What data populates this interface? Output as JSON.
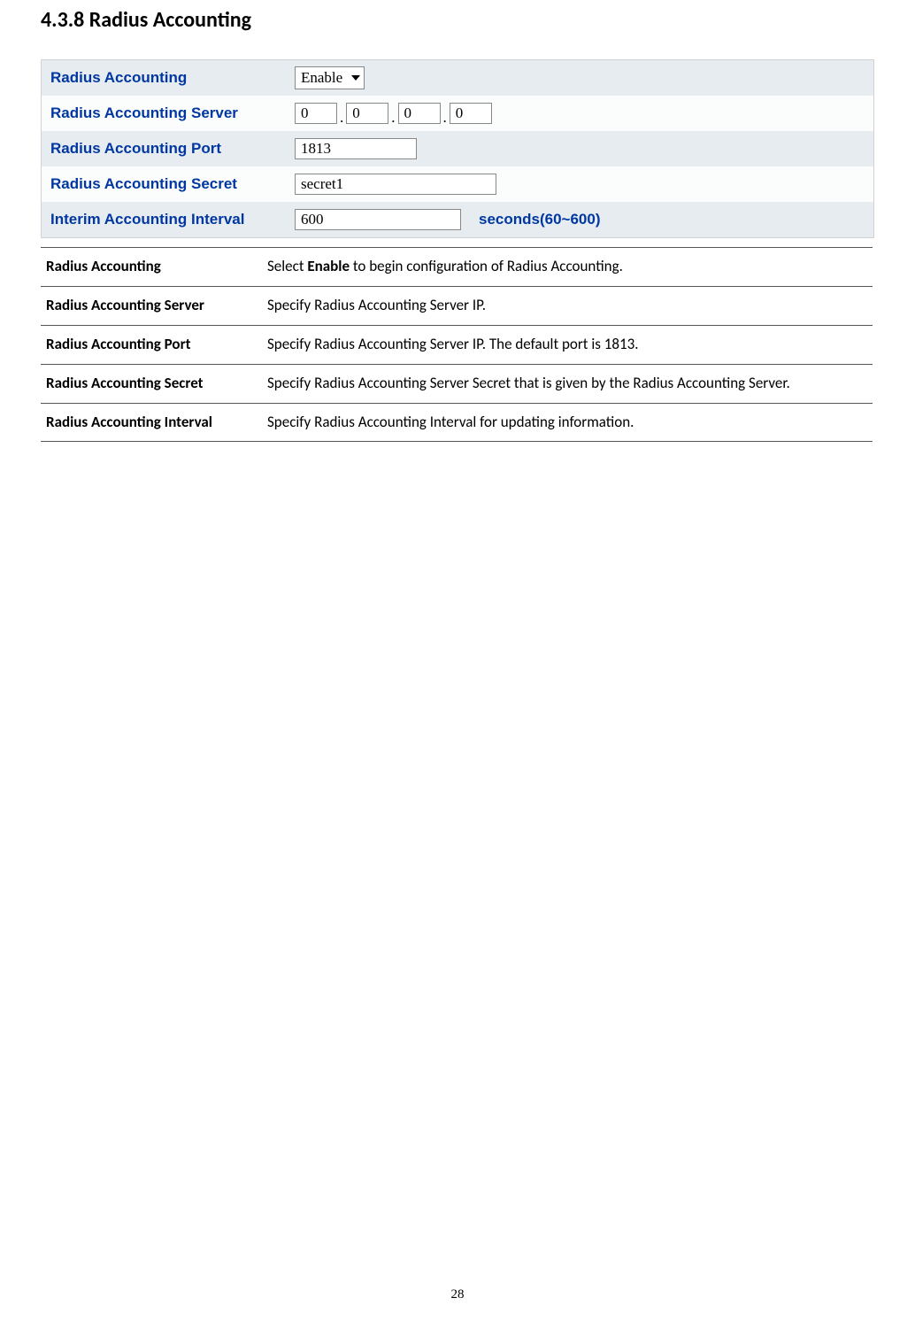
{
  "heading": "4.3.8 Radius Accounting",
  "config": {
    "rows": [
      {
        "label": "Radius Accounting",
        "type": "select",
        "value": "Enable"
      },
      {
        "label": "Radius Accounting Server",
        "type": "ip",
        "octets": [
          "0",
          "0",
          "0",
          "0"
        ]
      },
      {
        "label": "Radius Accounting Port",
        "type": "text",
        "value": "1813",
        "cls": "w-port"
      },
      {
        "label": "Radius Accounting Secret",
        "type": "text",
        "value": "secret1",
        "cls": "w-secret"
      },
      {
        "label": "Interim Accounting Interval",
        "type": "text",
        "value": "600",
        "cls": "w-interval",
        "suffix": "seconds(60~600)"
      }
    ]
  },
  "desc": [
    {
      "key": "Radius Accounting",
      "pre": "Select ",
      "strong": "Enable",
      "post": " to begin configuration of Radius Accounting."
    },
    {
      "key": "Radius Accounting Server",
      "pre": "Specify Radius Accounting Server IP.",
      "strong": "",
      "post": ""
    },
    {
      "key": "Radius Accounting Port",
      "pre": "Specify Radius Accounting Server IP. The default port is 1813.",
      "strong": "",
      "post": ""
    },
    {
      "key": "Radius Accounting Secret",
      "pre": "Specify Radius Accounting Server Secret that is given by the Radius Accounting Server.",
      "strong": "",
      "post": ""
    },
    {
      "key": "Radius Accounting Interval",
      "pre": "Specify Radius Accounting Interval for updating information.",
      "strong": "",
      "post": ""
    }
  ],
  "page_number": "28"
}
